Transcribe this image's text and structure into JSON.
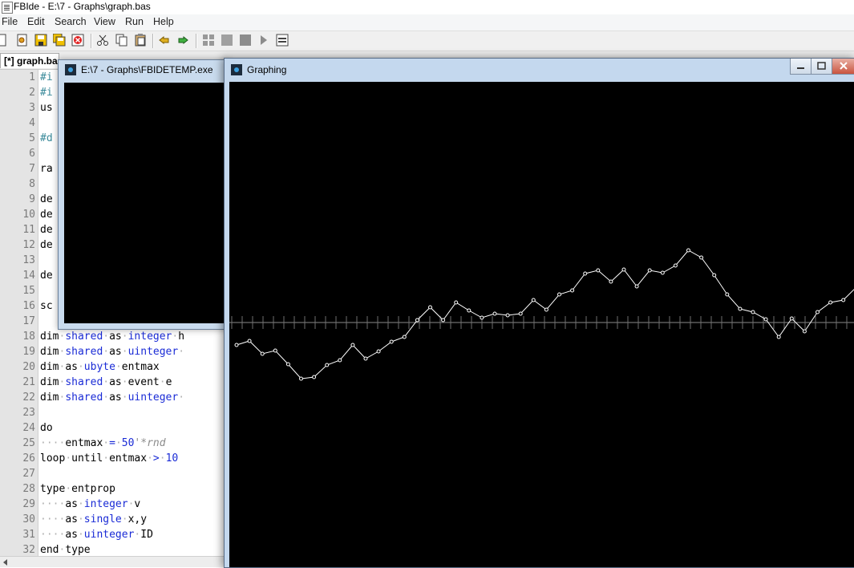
{
  "app": {
    "title": "FBIde - E:\\7 - Graphs\\graph.bas"
  },
  "menu": [
    "File",
    "Edit",
    "Search",
    "View",
    "Run",
    "Help"
  ],
  "toolbar": {
    "icons": [
      "new-file-icon",
      "open-file-icon",
      "save-icon",
      "save-all-icon",
      "close-file-icon",
      "cut-icon",
      "copy-icon",
      "paste-icon",
      "undo-icon",
      "redo-icon",
      "compile-icon",
      "compile-run-icon",
      "run-icon",
      "quick-run-icon",
      "cmd-prompt-icon"
    ]
  },
  "editor": {
    "tab_label": "[*] graph.bas",
    "lines": [
      {
        "n": "1",
        "t": "#i"
      },
      {
        "n": "2",
        "t": "#i"
      },
      {
        "n": "3",
        "t": "us"
      },
      {
        "n": "4",
        "t": ""
      },
      {
        "n": "5",
        "t": "#d"
      },
      {
        "n": "6",
        "t": ""
      },
      {
        "n": "7",
        "t": "ra"
      },
      {
        "n": "8",
        "t": ""
      },
      {
        "n": "9",
        "t": "de"
      },
      {
        "n": "10",
        "t": "de"
      },
      {
        "n": "11",
        "t": "de"
      },
      {
        "n": "12",
        "t": "de"
      },
      {
        "n": "13",
        "t": ""
      },
      {
        "n": "14",
        "t": "de"
      },
      {
        "n": "15",
        "t": ""
      },
      {
        "n": "16",
        "t": "sc"
      },
      {
        "n": "17",
        "t": ""
      },
      {
        "n": "18",
        "t": "dim·shared·as·integer·h"
      },
      {
        "n": "19",
        "t": "dim·shared·as·uinteger·"
      },
      {
        "n": "20",
        "t": "dim·as·ubyte·entmax"
      },
      {
        "n": "21",
        "t": "dim·shared·as·event·e"
      },
      {
        "n": "22",
        "t": "dim·shared·as·uinteger·"
      },
      {
        "n": "23",
        "t": ""
      },
      {
        "n": "24",
        "t": "do"
      },
      {
        "n": "25",
        "t": "····entmax·=·50'*rnd"
      },
      {
        "n": "26",
        "t": "loop·until·entmax·>·10"
      },
      {
        "n": "27",
        "t": ""
      },
      {
        "n": "28",
        "t": "type·entprop"
      },
      {
        "n": "29",
        "t": "····as·integer·v"
      },
      {
        "n": "30",
        "t": "····as·single·x,y"
      },
      {
        "n": "31",
        "t": "····as·uinteger·ID"
      },
      {
        "n": "32",
        "t": "end·type"
      }
    ]
  },
  "console_window": {
    "title": "E:\\7 - Graphs\\FBIDETEMP.exe"
  },
  "graph_window": {
    "title": "Graphing"
  },
  "chart_data": {
    "type": "line",
    "title": "",
    "xlabel": "",
    "ylabel": "",
    "grid": false,
    "line_color": "#ffffff",
    "background": "#000000",
    "baseline_ticks": true,
    "baseline_y": 0,
    "x": [
      0,
      1,
      2,
      3,
      4,
      5,
      6,
      7,
      8,
      9,
      10,
      11,
      12,
      13,
      14,
      15,
      16,
      17,
      18,
      19,
      20,
      21,
      22,
      23,
      24,
      25,
      26,
      27,
      28,
      29,
      30,
      31,
      32,
      33,
      34,
      35,
      36,
      37,
      38,
      39,
      40,
      41,
      42,
      43,
      44,
      45,
      46,
      47
    ],
    "y": [
      -28,
      -23,
      -39,
      -35,
      -52,
      -70,
      -68,
      -53,
      -47,
      -28,
      -45,
      -36,
      -24,
      -18,
      3,
      19,
      3,
      25,
      15,
      6,
      11,
      9,
      11,
      28,
      16,
      35,
      40,
      61,
      65,
      51,
      66,
      45,
      65,
      62,
      71,
      90,
      81,
      59,
      35,
      17,
      13,
      4,
      -18,
      5,
      -11,
      13,
      25,
      28,
      44
    ]
  },
  "colors": {
    "titlebar_active": "#c4d8ee",
    "keyword": "#1a2bd6",
    "comment": "#8c8c8c"
  }
}
